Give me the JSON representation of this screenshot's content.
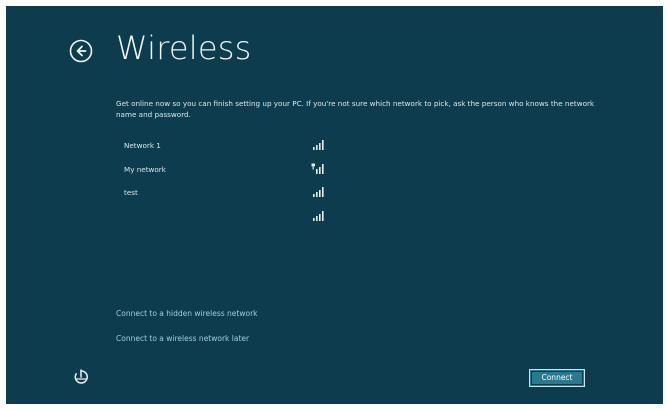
{
  "page": {
    "title": "Wireless",
    "description": "Get online now so you can finish setting up your PC. If you're not sure which network to pick, ask the person who knows the network name and password."
  },
  "networks": [
    {
      "name": "Network 1",
      "icon": "wifi-signal-icon"
    },
    {
      "name": "My network",
      "icon": "wifi-signal-secured-icon"
    },
    {
      "name": "test",
      "icon": "wifi-signal-icon"
    },
    {
      "name": "",
      "icon": "wifi-signal-icon"
    }
  ],
  "links": {
    "hidden_network": "Connect to a hidden wireless network",
    "later": "Connect to a wireless network later"
  },
  "footer": {
    "connect_label": "Connect"
  },
  "icons": {
    "back": "back-arrow-icon",
    "power": "ease-of-access-icon"
  },
  "colors": {
    "background": "#0c3c4e",
    "link": "#9fd0de",
    "button": "#2a7a8f"
  }
}
